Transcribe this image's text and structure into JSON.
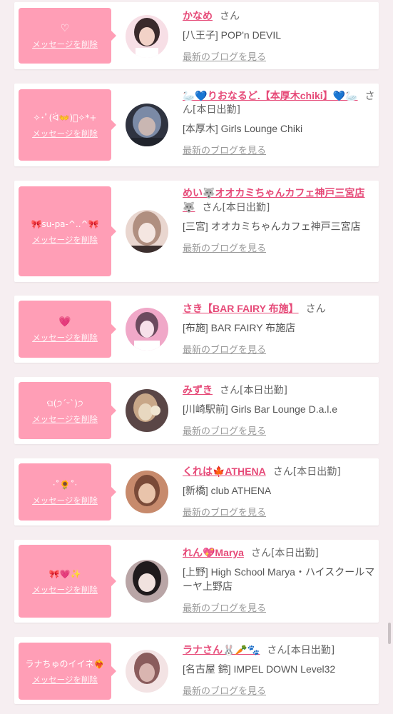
{
  "colors": {
    "page_bg": "#f6eef1",
    "bubble_bg": "#ff9eb6",
    "name_color": "#e64a78",
    "link_gray": "#999999"
  },
  "entries": [
    {
      "bubble": "♡",
      "delete_label": "メッセージを削除",
      "name": "かなめ",
      "san": "さん",
      "status": "",
      "shop": "[八王子] POP'n DEVIL",
      "blog_link": "最新のブログを見る",
      "avatar_colors": [
        "#f7dfe6",
        "#3a2a2c",
        "#f2d2c7"
      ]
    },
    {
      "bubble": "✧･ﾟ(ᐛ👐)ﾟ✧*+",
      "delete_label": "メッセージを削除",
      "name": "🦢💙りおなるど.【本厚木chiki】💙🦢",
      "san": "さん",
      "status": "[本日出勤]",
      "shop": "[本厚木] Girls Lounge Chiki",
      "blog_link": "最新のブログを見る",
      "avatar_colors": [
        "#2f3340",
        "#7b8aa6",
        "#c9b6b2"
      ]
    },
    {
      "bubble": "🎀su-pa-^..^🎀",
      "delete_label": "メッセージを削除",
      "name": "めい🐺オオカミちゃんカフェ神戸三宮店🐺",
      "san": "さん",
      "status": "[本日出勤]",
      "shop": "[三宮] オオカミちゃんカフェ神戸三宮店",
      "blog_link": "最新のブログを見る",
      "avatar_colors": [
        "#e9d6cf",
        "#b08f80",
        "#f4e6e1"
      ]
    },
    {
      "bubble": "💗",
      "delete_label": "メッセージを削除",
      "name": "さき【BAR FAIRY 布施】",
      "san": "さん",
      "status": "",
      "shop": "[布施] BAR FAIRY 布施店",
      "blog_link": "最新のブログを見る",
      "avatar_colors": [
        "#f0a8c8",
        "#6b4a5e",
        "#f7e1ea"
      ]
    },
    {
      "bubble": "ଘ(੭ˊᵕˋ)੭",
      "delete_label": "メッセージを削除",
      "name": "みずき",
      "san": "さん",
      "status": "[本日出勤]",
      "shop": "[川崎駅前] Girls Bar Lounge D.a.l.e",
      "blog_link": "最新のブログを見る",
      "avatar_colors": [
        "#5a4646",
        "#c8a788",
        "#e8d8c0"
      ]
    },
    {
      "bubble": "·˚🌻˚·",
      "delete_label": "メッセージを削除",
      "name": "くれは🍁ATHENA",
      "san": "さん",
      "status": "[本日出勤]",
      "shop": "[新橋] club ATHENA",
      "blog_link": "最新のブログを見る",
      "avatar_colors": [
        "#c78a6c",
        "#e9c4ab",
        "#7a4a38"
      ]
    },
    {
      "bubble": "🎀💗✨",
      "delete_label": "メッセージを削除",
      "name": "れん💖Marya",
      "san": "さん",
      "status": "[本日出勤]",
      "shop": "[上野] High School Marya・ハイスクールマーヤ上野店",
      "blog_link": "最新のブログを見る",
      "avatar_colors": [
        "#1f1a1c",
        "#f1e2df",
        "#b9a5a6"
      ]
    },
    {
      "bubble": "ラナちゅのイイネ❤️‍🔥",
      "delete_label": "メッセージを削除",
      "name": "ラナさん🐰🥕🐾",
      "san": "さん",
      "status": "[本日出勤]",
      "shop": "[名古屋 錦] IMPEL DOWN Level32",
      "blog_link": "最新のブログを見る",
      "avatar_colors": [
        "#f3e3e4",
        "#8a5c5c",
        "#d9b5b0"
      ]
    }
  ]
}
